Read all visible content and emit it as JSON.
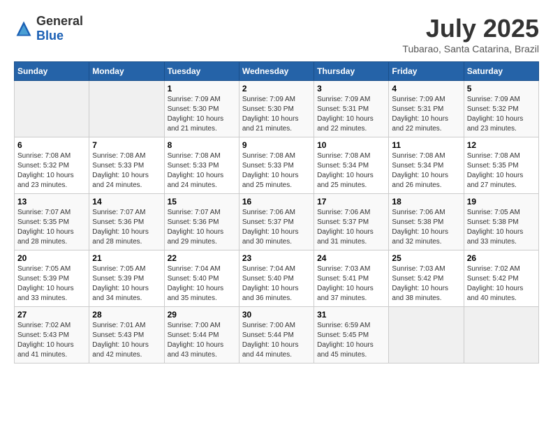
{
  "header": {
    "logo_general": "General",
    "logo_blue": "Blue",
    "title": "July 2025",
    "location": "Tubarao, Santa Catarina, Brazil"
  },
  "days_of_week": [
    "Sunday",
    "Monday",
    "Tuesday",
    "Wednesday",
    "Thursday",
    "Friday",
    "Saturday"
  ],
  "weeks": [
    [
      {
        "day": "",
        "empty": true
      },
      {
        "day": "",
        "empty": true
      },
      {
        "day": "1",
        "sunrise": "Sunrise: 7:09 AM",
        "sunset": "Sunset: 5:30 PM",
        "daylight": "Daylight: 10 hours and 21 minutes."
      },
      {
        "day": "2",
        "sunrise": "Sunrise: 7:09 AM",
        "sunset": "Sunset: 5:30 PM",
        "daylight": "Daylight: 10 hours and 21 minutes."
      },
      {
        "day": "3",
        "sunrise": "Sunrise: 7:09 AM",
        "sunset": "Sunset: 5:31 PM",
        "daylight": "Daylight: 10 hours and 22 minutes."
      },
      {
        "day": "4",
        "sunrise": "Sunrise: 7:09 AM",
        "sunset": "Sunset: 5:31 PM",
        "daylight": "Daylight: 10 hours and 22 minutes."
      },
      {
        "day": "5",
        "sunrise": "Sunrise: 7:09 AM",
        "sunset": "Sunset: 5:32 PM",
        "daylight": "Daylight: 10 hours and 23 minutes."
      }
    ],
    [
      {
        "day": "6",
        "sunrise": "Sunrise: 7:08 AM",
        "sunset": "Sunset: 5:32 PM",
        "daylight": "Daylight: 10 hours and 23 minutes."
      },
      {
        "day": "7",
        "sunrise": "Sunrise: 7:08 AM",
        "sunset": "Sunset: 5:33 PM",
        "daylight": "Daylight: 10 hours and 24 minutes."
      },
      {
        "day": "8",
        "sunrise": "Sunrise: 7:08 AM",
        "sunset": "Sunset: 5:33 PM",
        "daylight": "Daylight: 10 hours and 24 minutes."
      },
      {
        "day": "9",
        "sunrise": "Sunrise: 7:08 AM",
        "sunset": "Sunset: 5:33 PM",
        "daylight": "Daylight: 10 hours and 25 minutes."
      },
      {
        "day": "10",
        "sunrise": "Sunrise: 7:08 AM",
        "sunset": "Sunset: 5:34 PM",
        "daylight": "Daylight: 10 hours and 25 minutes."
      },
      {
        "day": "11",
        "sunrise": "Sunrise: 7:08 AM",
        "sunset": "Sunset: 5:34 PM",
        "daylight": "Daylight: 10 hours and 26 minutes."
      },
      {
        "day": "12",
        "sunrise": "Sunrise: 7:08 AM",
        "sunset": "Sunset: 5:35 PM",
        "daylight": "Daylight: 10 hours and 27 minutes."
      }
    ],
    [
      {
        "day": "13",
        "sunrise": "Sunrise: 7:07 AM",
        "sunset": "Sunset: 5:35 PM",
        "daylight": "Daylight: 10 hours and 28 minutes."
      },
      {
        "day": "14",
        "sunrise": "Sunrise: 7:07 AM",
        "sunset": "Sunset: 5:36 PM",
        "daylight": "Daylight: 10 hours and 28 minutes."
      },
      {
        "day": "15",
        "sunrise": "Sunrise: 7:07 AM",
        "sunset": "Sunset: 5:36 PM",
        "daylight": "Daylight: 10 hours and 29 minutes."
      },
      {
        "day": "16",
        "sunrise": "Sunrise: 7:06 AM",
        "sunset": "Sunset: 5:37 PM",
        "daylight": "Daylight: 10 hours and 30 minutes."
      },
      {
        "day": "17",
        "sunrise": "Sunrise: 7:06 AM",
        "sunset": "Sunset: 5:37 PM",
        "daylight": "Daylight: 10 hours and 31 minutes."
      },
      {
        "day": "18",
        "sunrise": "Sunrise: 7:06 AM",
        "sunset": "Sunset: 5:38 PM",
        "daylight": "Daylight: 10 hours and 32 minutes."
      },
      {
        "day": "19",
        "sunrise": "Sunrise: 7:05 AM",
        "sunset": "Sunset: 5:38 PM",
        "daylight": "Daylight: 10 hours and 33 minutes."
      }
    ],
    [
      {
        "day": "20",
        "sunrise": "Sunrise: 7:05 AM",
        "sunset": "Sunset: 5:39 PM",
        "daylight": "Daylight: 10 hours and 33 minutes."
      },
      {
        "day": "21",
        "sunrise": "Sunrise: 7:05 AM",
        "sunset": "Sunset: 5:39 PM",
        "daylight": "Daylight: 10 hours and 34 minutes."
      },
      {
        "day": "22",
        "sunrise": "Sunrise: 7:04 AM",
        "sunset": "Sunset: 5:40 PM",
        "daylight": "Daylight: 10 hours and 35 minutes."
      },
      {
        "day": "23",
        "sunrise": "Sunrise: 7:04 AM",
        "sunset": "Sunset: 5:40 PM",
        "daylight": "Daylight: 10 hours and 36 minutes."
      },
      {
        "day": "24",
        "sunrise": "Sunrise: 7:03 AM",
        "sunset": "Sunset: 5:41 PM",
        "daylight": "Daylight: 10 hours and 37 minutes."
      },
      {
        "day": "25",
        "sunrise": "Sunrise: 7:03 AM",
        "sunset": "Sunset: 5:42 PM",
        "daylight": "Daylight: 10 hours and 38 minutes."
      },
      {
        "day": "26",
        "sunrise": "Sunrise: 7:02 AM",
        "sunset": "Sunset: 5:42 PM",
        "daylight": "Daylight: 10 hours and 40 minutes."
      }
    ],
    [
      {
        "day": "27",
        "sunrise": "Sunrise: 7:02 AM",
        "sunset": "Sunset: 5:43 PM",
        "daylight": "Daylight: 10 hours and 41 minutes."
      },
      {
        "day": "28",
        "sunrise": "Sunrise: 7:01 AM",
        "sunset": "Sunset: 5:43 PM",
        "daylight": "Daylight: 10 hours and 42 minutes."
      },
      {
        "day": "29",
        "sunrise": "Sunrise: 7:00 AM",
        "sunset": "Sunset: 5:44 PM",
        "daylight": "Daylight: 10 hours and 43 minutes."
      },
      {
        "day": "30",
        "sunrise": "Sunrise: 7:00 AM",
        "sunset": "Sunset: 5:44 PM",
        "daylight": "Daylight: 10 hours and 44 minutes."
      },
      {
        "day": "31",
        "sunrise": "Sunrise: 6:59 AM",
        "sunset": "Sunset: 5:45 PM",
        "daylight": "Daylight: 10 hours and 45 minutes."
      },
      {
        "day": "",
        "empty": true
      },
      {
        "day": "",
        "empty": true
      }
    ]
  ]
}
